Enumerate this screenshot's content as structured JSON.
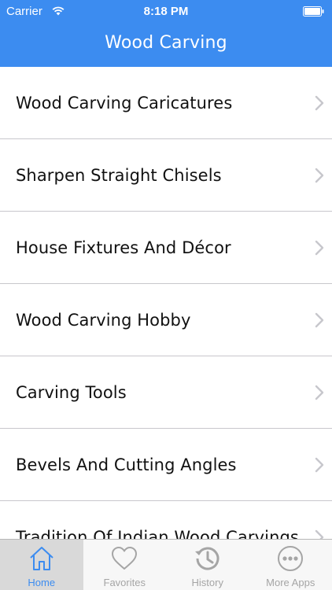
{
  "status_bar": {
    "carrier": "Carrier",
    "time": "8:18 PM",
    "wifi_icon": "wifi-icon",
    "battery_icon": "battery-icon"
  },
  "nav": {
    "title": "Wood Carving"
  },
  "list": {
    "items": [
      {
        "label": "Wood Carving Caricatures"
      },
      {
        "label": "Sharpen Straight Chisels"
      },
      {
        "label": "House Fixtures And Décor"
      },
      {
        "label": "Wood Carving Hobby"
      },
      {
        "label": "Carving Tools"
      },
      {
        "label": "Bevels And Cutting Angles"
      },
      {
        "label": "Tradition Of Indian Wood Carvings"
      }
    ]
  },
  "tab_bar": {
    "tabs": [
      {
        "label": "Home",
        "icon": "home-icon",
        "active": true
      },
      {
        "label": "Favorites",
        "icon": "heart-icon",
        "active": false
      },
      {
        "label": "History",
        "icon": "history-icon",
        "active": false
      },
      {
        "label": "More Apps",
        "icon": "more-icon",
        "active": false
      }
    ]
  },
  "colors": {
    "accent": "#3c8cf0",
    "separator": "#c8c7cc",
    "tab_inactive": "#a5a5a5",
    "chevron": "#c7c7cc"
  }
}
